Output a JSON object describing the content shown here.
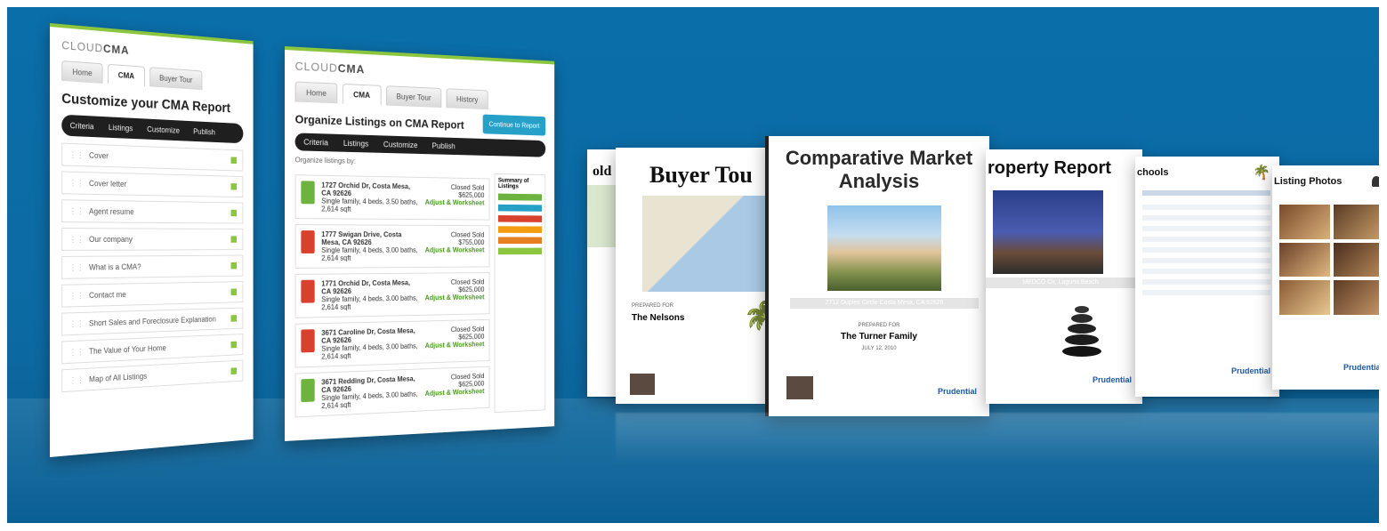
{
  "brand": {
    "logo_light": "CLOUD",
    "logo_bold": "CMA"
  },
  "panel1": {
    "tabs": [
      "Home",
      "CMA",
      "Buyer Tour"
    ],
    "heading": "Customize your CMA Report",
    "steps": [
      "Criteria",
      "Listings",
      "Customize",
      "Publish"
    ],
    "sections": [
      "Cover",
      "Cover letter",
      "Agent resume",
      "Our company",
      "What is a CMA?",
      "Contact me",
      "Short Sales and Foreclosure Explanation",
      "The Value of Your Home",
      "Map of All Listings"
    ]
  },
  "panel2": {
    "tabs": [
      "Home",
      "CMA",
      "Buyer Tour",
      "History"
    ],
    "heading": "Organize Listings on CMA Report",
    "steps": [
      "Criteria",
      "Listings",
      "Customize",
      "Publish"
    ],
    "organize_label": "Organize listings by:",
    "listings": [
      {
        "addr": "1727 Orchid Dr, Costa Mesa, CA 92626",
        "detail": "Single family, 4 beds, 3.50 baths, 2,614 sqft",
        "status": "Closed Sold",
        "price": "$625,000"
      },
      {
        "addr": "1777 Swigan Drive, Costa Mesa, CA 92626",
        "detail": "Single family, 4 beds, 3.00 baths, 2,614 sqft",
        "status": "Closed Sold",
        "price": "$755,000"
      },
      {
        "addr": "1771 Orchid Dr, Costa Mesa, CA 92626",
        "detail": "Single family, 4 beds, 3.00 baths, 2,614 sqft",
        "status": "Closed Sold",
        "price": "$625,000"
      },
      {
        "addr": "3671 Caroline Dr, Costa Mesa, CA 92626",
        "detail": "Single family, 4 beds, 3.00 baths, 2,614 sqft",
        "status": "Closed Sold",
        "price": "$625,000"
      },
      {
        "addr": "3671 Redding Dr, Costa Mesa, CA 92626",
        "detail": "Single family, 4 beds, 3.00 baths, 2,614 sqft",
        "status": "Closed Sold",
        "price": "$625,000"
      }
    ],
    "action_link": "Adjust & Worksheet",
    "summary_title": "Summary of Listings",
    "continue_button": "Continue to Report"
  },
  "docs": {
    "buyer_tour": {
      "title": "Buyer Tou",
      "prepared_for_label": "PREPARED FOR",
      "client": "The Nelsons"
    },
    "cma": {
      "title_line1": "Comparative Market",
      "title_line2": "Analysis",
      "address": "2712 Duplex Circle Costa Mesa, CA 92626",
      "prepared_for_label": "PREPARED FOR",
      "client": "The Turner Family",
      "date": "JULY 12, 2010"
    },
    "property_report": {
      "title": "roperty Report",
      "address": "MEDCO Cir, Laguna Beach"
    },
    "schools": {
      "title": "chools"
    },
    "photos": {
      "title": "Listing Photos"
    },
    "partial_left": {
      "title": "old"
    },
    "company": "Prudential"
  }
}
